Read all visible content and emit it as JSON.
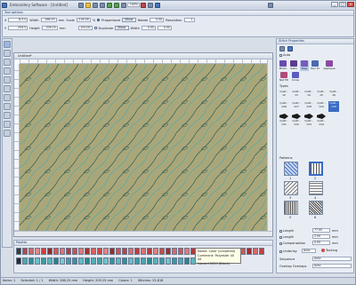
{
  "app": {
    "title": "Embroidery Software - [Untitled]"
  },
  "toolbar": {
    "zoom": "100%"
  },
  "tool_options": {
    "title": "Tool options",
    "row1": {
      "x_label": "X",
      "x": "-8.5 0",
      "w_label": "Width",
      "w": "266.25",
      "unit": "mm",
      "scale_label": "Scale",
      "scale": "100.00",
      "pct": "%",
      "proportional": "Proportional",
      "mirror": "Mirror",
      "rotate_label": "Rotate",
      "rotate": "0.00",
      "resolution_label": "Resolution",
      "resolution": "1"
    },
    "row2": {
      "y_label": "Y",
      "y": "-209.5",
      "h_label": "Height",
      "h": "209.25",
      "unit": "mm",
      "scale2": "100.00",
      "duplicate": "Duplicate",
      "mirror2": "Mirror",
      "skew_label": "Width",
      "skew": "0.00",
      "skew2": "0.00"
    }
  },
  "document": {
    "tab": "Untitled*"
  },
  "palette": {
    "title": "Palette",
    "tooltip": [
      "Name: Color (unnamed)",
      "Comment: Polyester 40 wt",
      "Isacord 0020 (Black)"
    ]
  },
  "right_panel": {
    "title": "Stitch Properties",
    "auto_label": "Auto",
    "stitch_types": [
      "Photo",
      "Satin",
      "Step",
      "Run M",
      "Applique",
      "Net Fill",
      "Cross"
    ],
    "types_label": "Types",
    "quilt_cells": [
      "Quilt - 12",
      "Quilt - 13",
      "Quilt - 14",
      "Quilt - 15",
      "Quilt - 16",
      "Quilt - 126",
      "Quilt - 127",
      "Quilt - 128",
      "Quilt - 129",
      "Quilt - 130",
      "Quilt - 131",
      "Quilt - 132",
      "Quilt - 133",
      "Quilt - 134"
    ],
    "patterns_label": "Patterns",
    "pattern_nums": [
      "1",
      "2",
      "3",
      "4",
      "5",
      "6"
    ],
    "fields": [
      {
        "label": "Length",
        "value": "77.00",
        "unit": "mm"
      },
      {
        "label": "Length",
        "value": "2.00",
        "unit": "mm"
      },
      {
        "label": "Compensation",
        "value": "0.00",
        "unit": "mm"
      }
    ],
    "underlay_label": "Underlay",
    "underlay_value": "Auto",
    "tacking_label": "Tacking",
    "sequence_label": "Sequence",
    "sequence_value": "Auto",
    "overlap_label": "Overlap Overlaps",
    "overlap_value": "Auto"
  },
  "status": {
    "items": [
      "Items: 1",
      "Selected: 1 / 1",
      "Width: 266.25 mm",
      "Height: 209.25 mm",
      "Colors: 1",
      "Stitches: 25,618"
    ]
  },
  "colors": {
    "fabric": "#a9a77a",
    "accent": "#3a6bc4",
    "teal": "#4aa8b0"
  }
}
